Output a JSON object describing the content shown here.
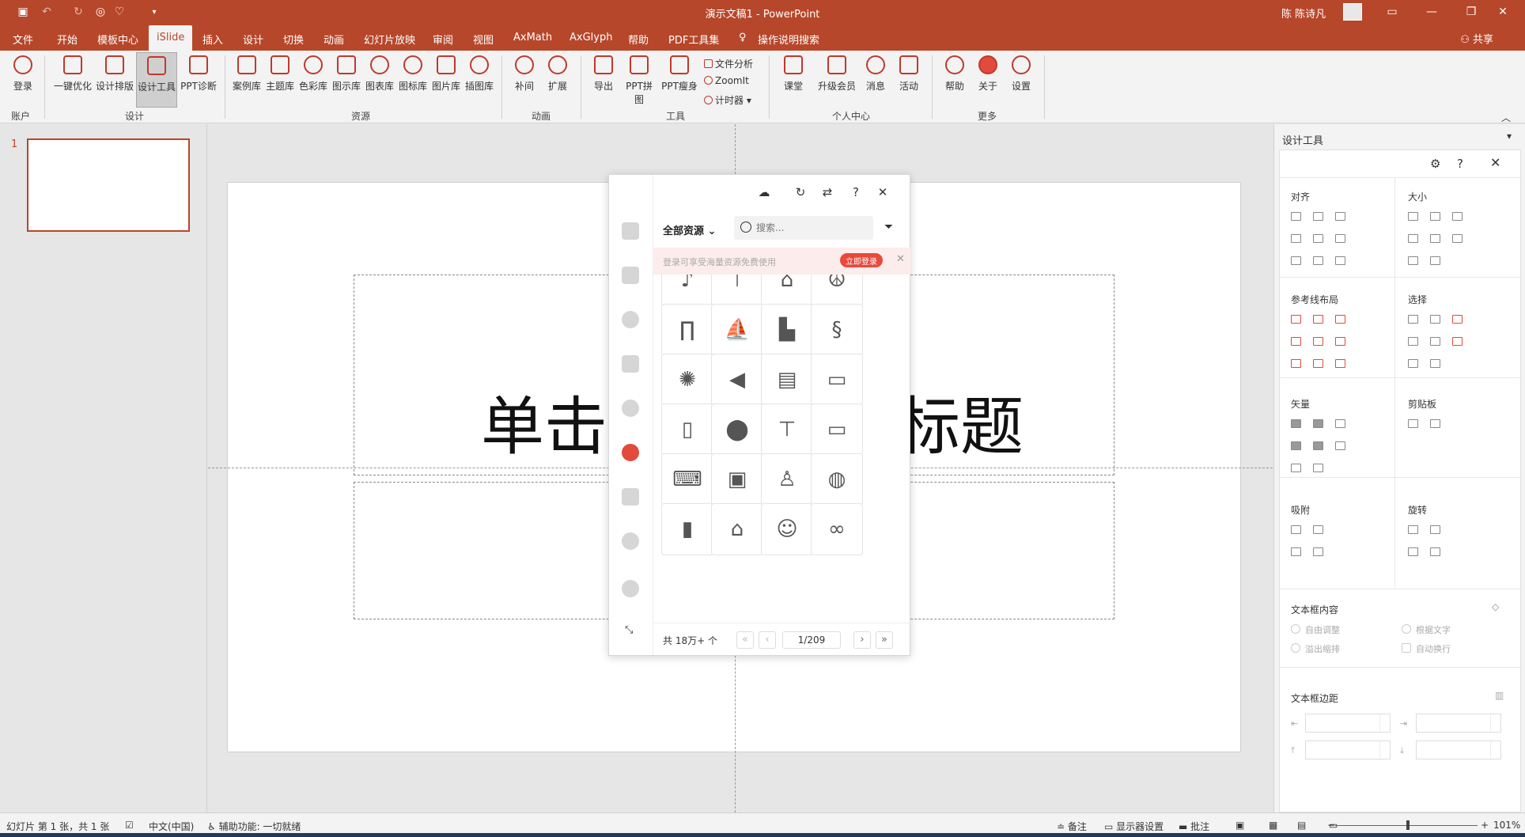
{
  "app": {
    "window_title": "演示文稿1  -  PowerPoint",
    "user_name": "陈 陈诗凡",
    "share_label": "共享"
  },
  "menu_tabs": [
    {
      "label": "文件"
    },
    {
      "label": "开始"
    },
    {
      "label": "模板中心"
    },
    {
      "label": "iSlide",
      "active": true
    },
    {
      "label": "插入"
    },
    {
      "label": "设计"
    },
    {
      "label": "切换"
    },
    {
      "label": "动画"
    },
    {
      "label": "幻灯片放映"
    },
    {
      "label": "审阅"
    },
    {
      "label": "视图"
    },
    {
      "label": "AxMath"
    },
    {
      "label": "AxGlyph"
    },
    {
      "label": "帮助"
    },
    {
      "label": "PDF工具集"
    },
    {
      "label": "操作说明搜索"
    }
  ],
  "ribbon": {
    "login": "登录",
    "one_click_optimize": "一键优化",
    "design_layout": "设计排版",
    "design_tools": "设计工具",
    "ppt_diagnosis": "PPT诊断",
    "case_lib": "案例库",
    "theme_lib": "主题库",
    "color_lib": "色彩库",
    "diagram_lib": "图示库",
    "chart_lib": "图表库",
    "icon_lib": "图标库",
    "image_lib": "图片库",
    "illustration_lib": "插图库",
    "tween": "补间",
    "extend": "扩展",
    "export": "导出",
    "ppt_merge": "PPT拼图",
    "ppt_slim": "PPT瘦身",
    "file_analysis": "文件分析",
    "zoomit": "ZoomIt",
    "timer": "计时器",
    "classroom": "课堂",
    "upgrade": "升级会员",
    "messages": "消息",
    "activity": "活动",
    "help": "帮助",
    "about": "关于",
    "settings": "设置",
    "groups": {
      "account": "账户",
      "design": "设计",
      "resources": "资源",
      "animation": "动画",
      "tools": "工具",
      "personal": "个人中心",
      "more": "更多"
    }
  },
  "thumbnails": {
    "slide_number": "1"
  },
  "slide": {
    "title_left": "单击",
    "title_right": "标题"
  },
  "resource_panel": {
    "category": "全部资源",
    "search_placeholder": "搜索...",
    "banner_text": "登录可享受海量资源免费使用",
    "login_button": "立即登录",
    "total": "共 18万+ 个",
    "page": "1/209",
    "icons": [
      "saxophone",
      "lamp-post",
      "balance",
      "peace",
      "trousers",
      "jet-ski",
      "flood",
      "seahorse",
      "loading",
      "megaphone",
      "monitor-chip",
      "display-code",
      "document-chart",
      "location-pin",
      "billboard",
      "id-card",
      "laptop-chart",
      "radio-tv",
      "person-bulb",
      "globe",
      "html-file",
      "bank",
      "person-avatar",
      "rings"
    ]
  },
  "design_pane": {
    "title": "设计工具",
    "sections": {
      "align": "对齐",
      "size": "大小",
      "guide_layout": "参考线布局",
      "select": "选择",
      "vector": "矢量",
      "clipboard": "剪贴板",
      "snap": "吸附",
      "rotate": "旋转",
      "textbox_content": "文本框内容",
      "textbox_margin": "文本框边距"
    },
    "textbox_options": {
      "auto_adjust": "自由调整",
      "fit_text": "根据文字",
      "overflow_shrink": "溢出缩排",
      "auto_wrap": "自动换行"
    }
  },
  "status": {
    "slide_info": "幻灯片 第 1 张，共 1 张",
    "language": "中文(中国)",
    "accessibility": "辅助功能: 一切就绪",
    "notes": "备注",
    "display_settings": "显示器设置",
    "comments": "批注",
    "zoom": "101%"
  },
  "colors": {
    "accent": "#b7472a",
    "islide_red": "#e24a3b"
  }
}
